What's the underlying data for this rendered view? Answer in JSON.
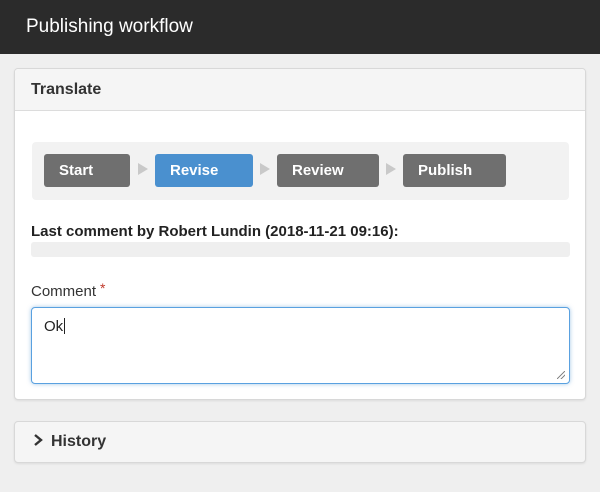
{
  "header": {
    "title": "Publishing workflow"
  },
  "translate_panel": {
    "title": "Translate",
    "steps": [
      {
        "label": "Start",
        "state": "inactive"
      },
      {
        "label": "Revise",
        "state": "active"
      },
      {
        "label": "Review",
        "state": "inactive"
      },
      {
        "label": "Publish",
        "state": "inactive"
      }
    ],
    "last_comment_label": "Last comment by Robert Lundin (2018-11-21 09:16):",
    "last_comment_text": "",
    "comment_label": "Comment",
    "required_marker": "*",
    "comment_value": "Ok"
  },
  "history_panel": {
    "title": "History"
  },
  "colors": {
    "active_step": "#4a90cf",
    "inactive_step": "#6f6f6f",
    "topbar": "#2b2b2b",
    "required": "#c0392b"
  }
}
